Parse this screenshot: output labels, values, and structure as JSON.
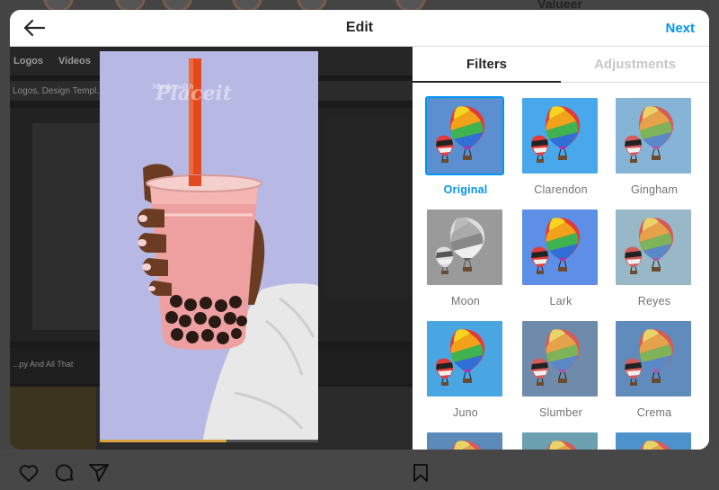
{
  "header": {
    "title": "Edit",
    "next_label": "Next"
  },
  "tabs": [
    {
      "label": "Filters",
      "active": true
    },
    {
      "label": "Adjustments",
      "active": false
    }
  ],
  "filters": [
    {
      "name": "Original",
      "selected": true,
      "sky": "#5b8fd0",
      "tone": "none"
    },
    {
      "name": "Clarendon",
      "selected": false,
      "sky": "#49a8ec",
      "tone": "vivid"
    },
    {
      "name": "Gingham",
      "selected": false,
      "sky": "#86b4d6",
      "tone": "soft"
    },
    {
      "name": "Moon",
      "selected": false,
      "sky": "#9a9a9a",
      "tone": "gray"
    },
    {
      "name": "Lark",
      "selected": false,
      "sky": "#5d8fe6",
      "tone": "vivid"
    },
    {
      "name": "Reyes",
      "selected": false,
      "sky": "#98b8c8",
      "tone": "soft"
    },
    {
      "name": "Juno",
      "selected": false,
      "sky": "#4aa6e2",
      "tone": "vivid"
    },
    {
      "name": "Slumber",
      "selected": false,
      "sky": "#6f8bab",
      "tone": "muted"
    },
    {
      "name": "Crema",
      "selected": false,
      "sky": "#5f8cbd",
      "tone": "muted"
    },
    {
      "name": "",
      "selected": false,
      "sky": "#5b8ab8",
      "tone": "muted"
    },
    {
      "name": "",
      "selected": false,
      "sky": "#6aa0b0",
      "tone": "muted"
    },
    {
      "name": "",
      "selected": false,
      "sky": "#4e92cc",
      "tone": "muted"
    }
  ],
  "photo": {
    "watermark_line1": "Made with",
    "watermark_line2": "Placeit",
    "background_color": "#b7b9e4"
  },
  "backdrop": {
    "nav_items": [
      "Logos",
      "Videos"
    ],
    "breadcrumb": "Logos, Design Templ...",
    "strip_text": "...py And All That",
    "profile_name": "Valueer"
  },
  "colors": {
    "accent": "#0095f6",
    "text": "#262626",
    "muted": "#737373"
  }
}
